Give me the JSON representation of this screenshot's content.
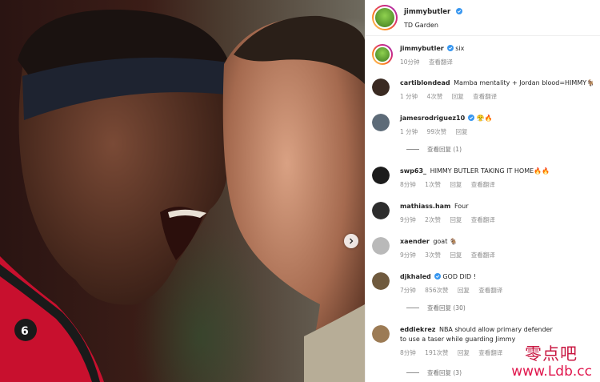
{
  "post": {
    "username": "jimmybutler",
    "location": "TD Garden",
    "caption": "six",
    "caption_time": "10分钟",
    "caption_translate": "查看翻译"
  },
  "comments": [
    {
      "user": "cartiblondead",
      "text": "Mamba mentality + Jordan blood=HIMMY🐐",
      "time": "1 分钟",
      "likes": "4次赞",
      "reply": "回复",
      "translate": "查看翻译",
      "avatar_color": "#3a2a22"
    },
    {
      "user": "jamesrodriguez10",
      "verified": true,
      "text": "😤🔥",
      "time": "1 分钟",
      "likes": "99次赞",
      "reply": "回复",
      "translate": "",
      "view_replies": "查看回复 (1)",
      "avatar_color": "#5d6b78"
    },
    {
      "user": "swp63_",
      "text": "HIMMY BUTLER TAKING IT HOME🔥🔥",
      "time": "8分钟",
      "likes": "1次赞",
      "reply": "回复",
      "translate": "查看翻译",
      "avatar_color": "#1c1c1c"
    },
    {
      "user": "mathiass.ham",
      "text": "Four",
      "time": "9分钟",
      "likes": "2次赞",
      "reply": "回复",
      "translate": "查看翻译",
      "avatar_color": "#2d2d2d"
    },
    {
      "user": "xaender",
      "text": "goat 🐐",
      "time": "9分钟",
      "likes": "3次赞",
      "reply": "回复",
      "translate": "查看翻译",
      "avatar_color": "#b9b9b9"
    },
    {
      "user": "djkhaled",
      "verified": true,
      "text": "GOD DID !",
      "time": "7分钟",
      "likes": "856次赞",
      "reply": "回复",
      "translate": "查看翻译",
      "view_replies": "查看回复 (30)",
      "avatar_color": "#6f5a3e"
    },
    {
      "user": "eddiekrez",
      "text": "NBA should allow primary defender to use a taser while guarding Jimmy",
      "time": "8分钟",
      "likes": "191次赞",
      "reply": "回复",
      "translate": "查看翻译",
      "view_replies": "查看回复 (3)",
      "avatar_color": "#9c7b55"
    }
  ],
  "watermark": {
    "line1": "零点吧",
    "line2": "www.Ldb.cc"
  },
  "colors": {
    "verified": "#3897f0",
    "meta": "#8e8e8e",
    "watermark": "#d6154a"
  },
  "icons": {
    "carousel_next": "chevron-right-icon",
    "verified": "verified-badge-icon"
  }
}
